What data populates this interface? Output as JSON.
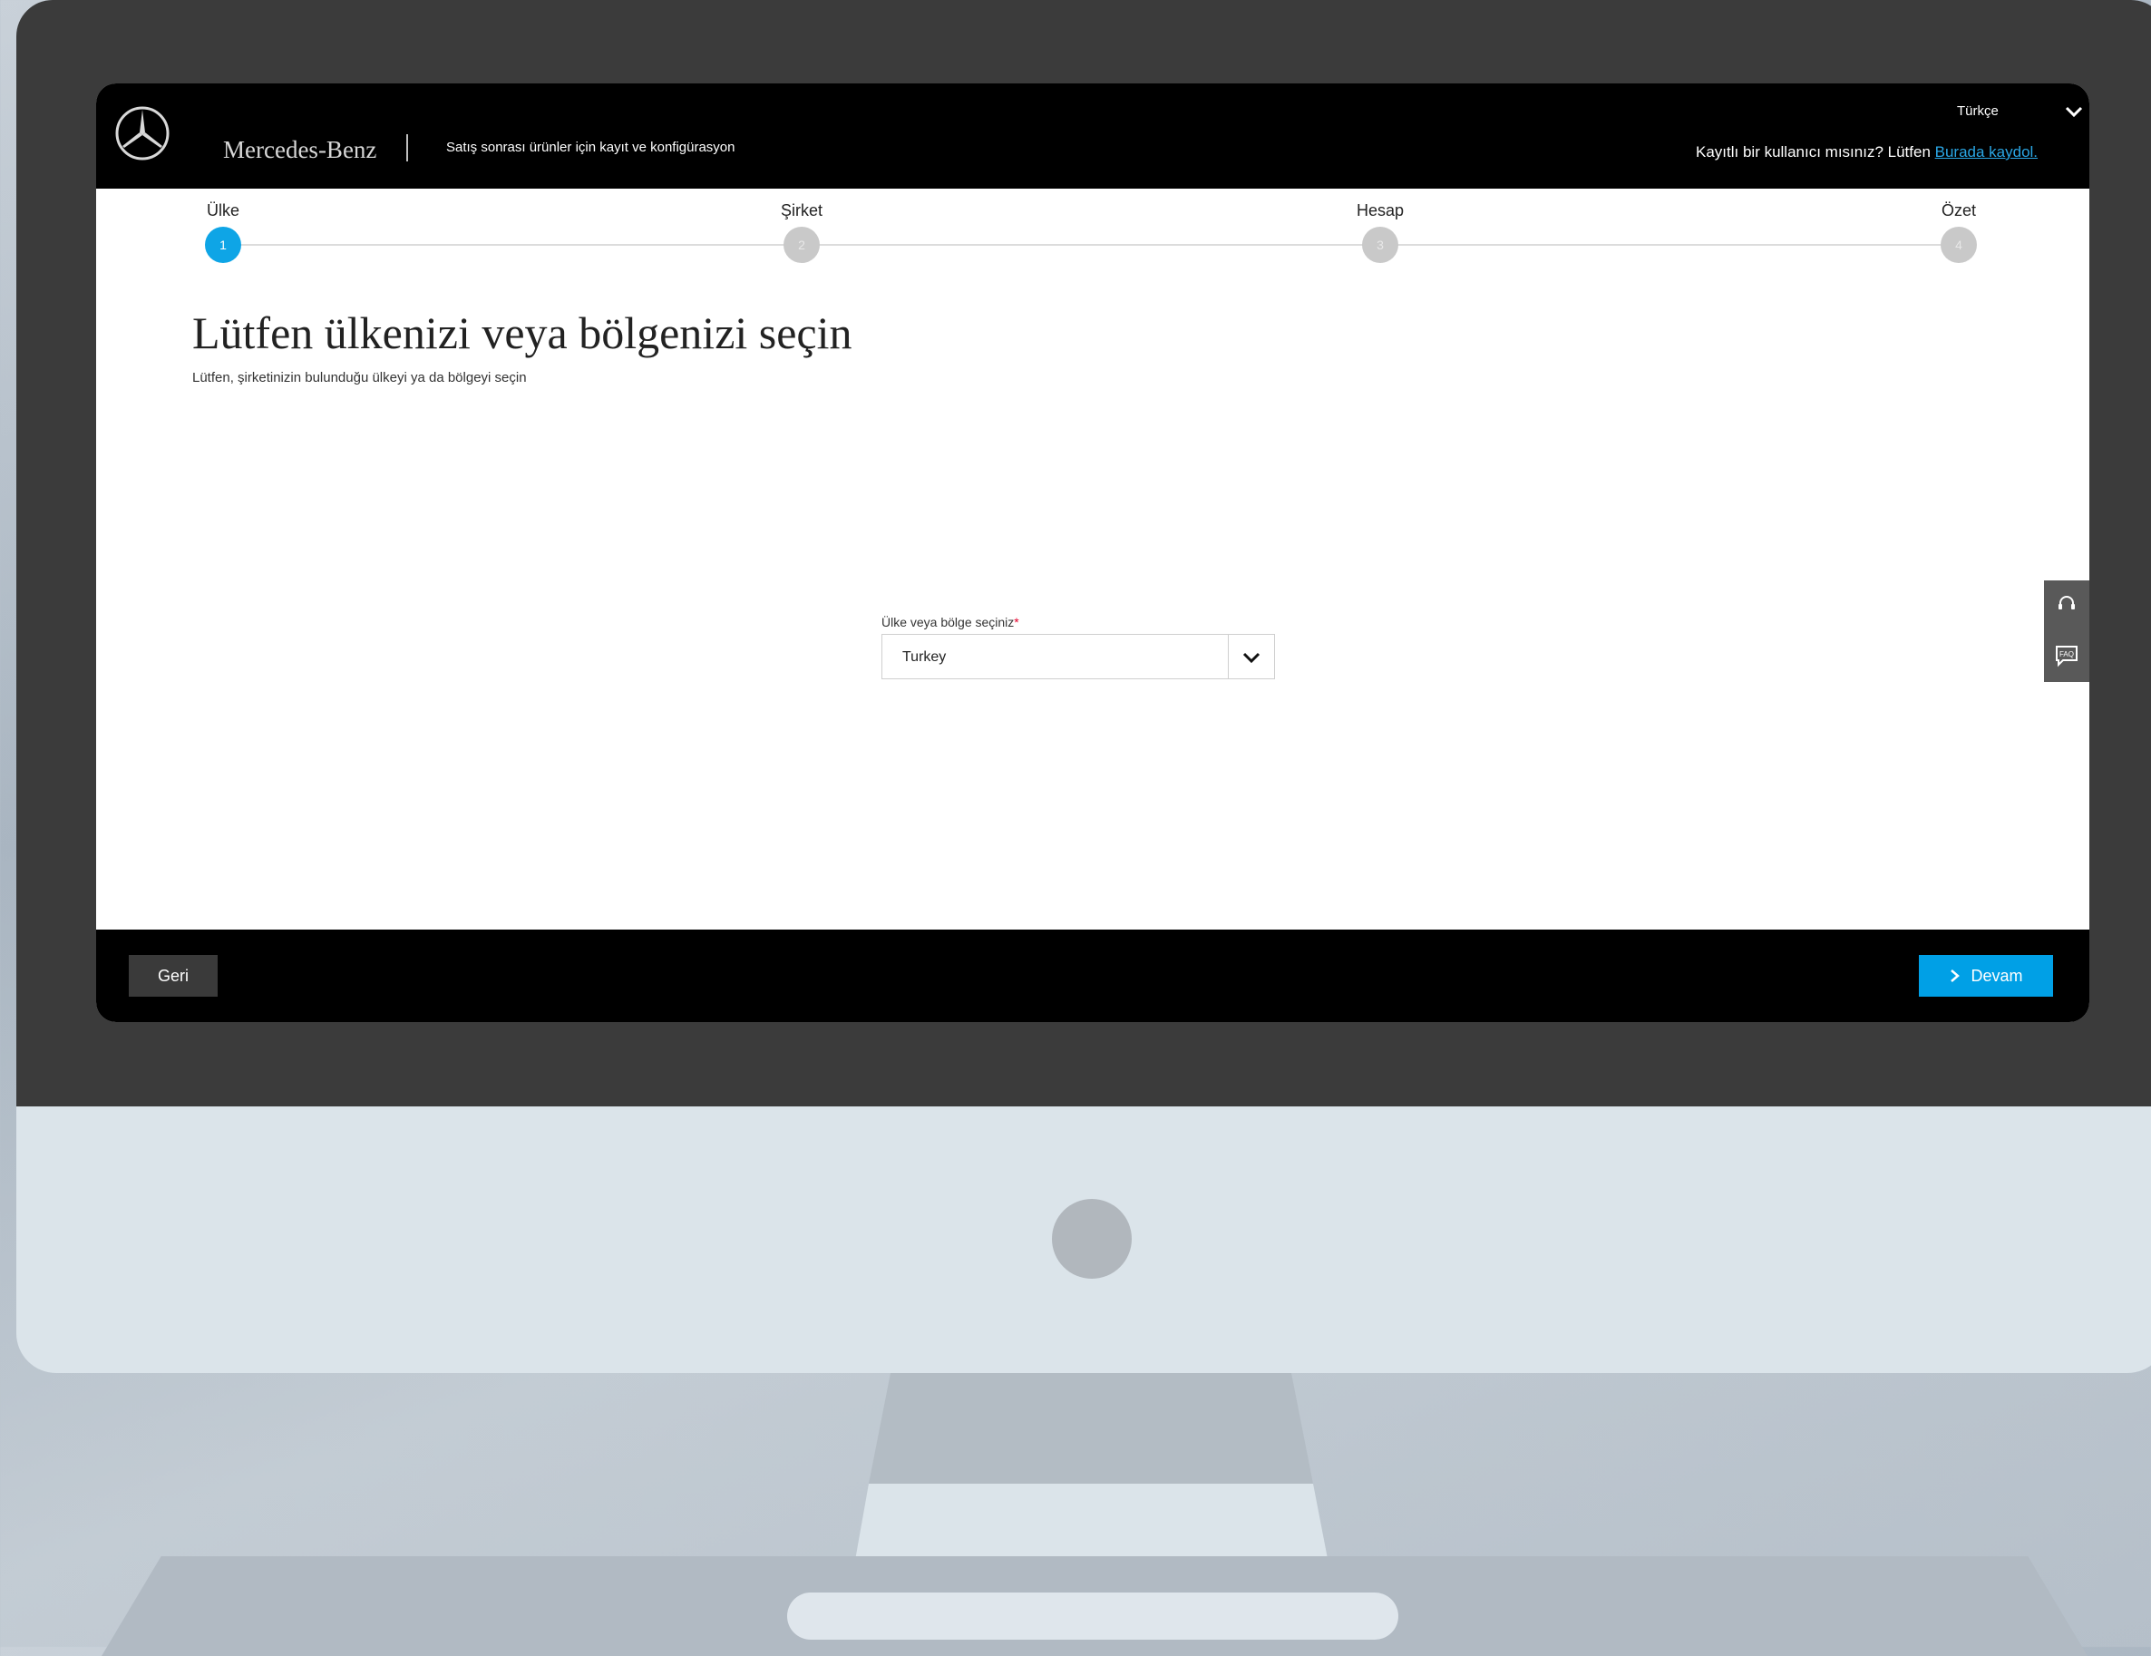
{
  "header": {
    "brand": "Mercedes-Benz",
    "subtitle": "Satış sonrası ürünler için kayıt ve konfigürasyon",
    "language": "Türkçe",
    "login_prompt": "Kayıtlı bir kullanıcı mısınız? Lütfen ",
    "login_link": "Burada kaydol."
  },
  "stepper": {
    "steps": [
      {
        "label": "Ülke",
        "number": "1",
        "active": true
      },
      {
        "label": "Şirket",
        "number": "2",
        "active": false
      },
      {
        "label": "Hesap",
        "number": "3",
        "active": false
      },
      {
        "label": "Özet",
        "number": "4",
        "active": false
      }
    ]
  },
  "main": {
    "title": "Lütfen ülkenizi veya bölgenizi seçin",
    "subtitle": "Lütfen, şirketinizin bulunduğu ülkeyi ya da bölgeyi seçin",
    "field_label": "Ülke veya bölge seçiniz",
    "required_mark": "*",
    "selected_country": "Turkey"
  },
  "side_tab": {
    "icons": [
      "headset-icon",
      "faq-icon"
    ],
    "faq_text": "FAQ"
  },
  "footer": {
    "back_label": "Geri",
    "next_label": "Devam"
  },
  "colors": {
    "accent": "#00a0e6",
    "topbar": "#000000",
    "bezel": "#3b3b3b"
  }
}
